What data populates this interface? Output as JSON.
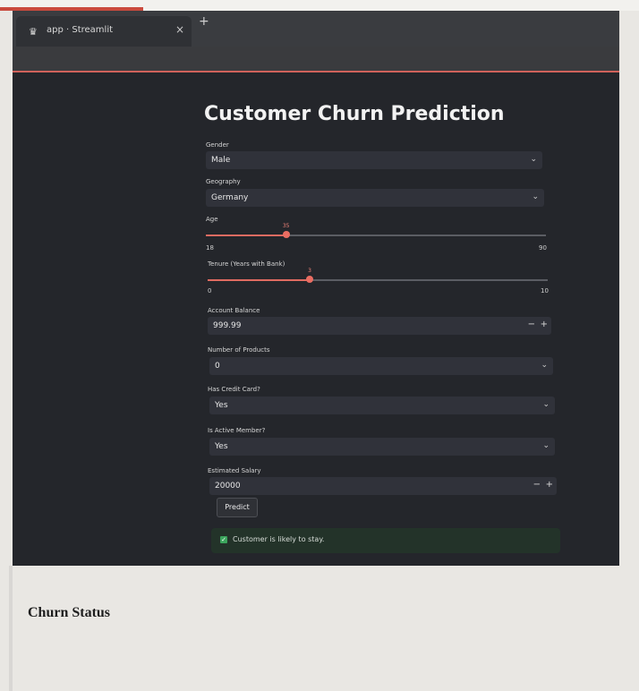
{
  "browser": {
    "tab_title": "app · Streamlit",
    "tab_close": "×",
    "new_tab": "+"
  },
  "app": {
    "title": "Customer Churn Prediction",
    "gender": {
      "label": "Gender",
      "value": "Male"
    },
    "geography": {
      "label": "Geography",
      "value": "Germany"
    },
    "age": {
      "label": "Age",
      "current": "35",
      "min": "18",
      "max": "90",
      "fraction": 0.236
    },
    "tenure": {
      "label": "Tenure (Years with Bank)",
      "current": "3",
      "min": "0",
      "max": "10",
      "fraction": 0.3
    },
    "account_balance": {
      "label": "Account Balance",
      "value": "999.99",
      "minus": "−",
      "plus": "+"
    },
    "num_products": {
      "label": "Number of Products",
      "value": "0"
    },
    "has_credit_card": {
      "label": "Has Credit Card?",
      "value": "Yes"
    },
    "is_active": {
      "label": "Is Active Member?",
      "value": "Yes"
    },
    "estimated_salary": {
      "label": "Estimated Salary",
      "value": "20000",
      "minus": "−",
      "plus": "+"
    },
    "predict_button": "Predict",
    "result": "Customer is likely to stay."
  },
  "page": {
    "heading": "Churn Status"
  },
  "colors": {
    "accent": "#ea6d62",
    "success": "#3ba55c",
    "background": "#24262b"
  }
}
